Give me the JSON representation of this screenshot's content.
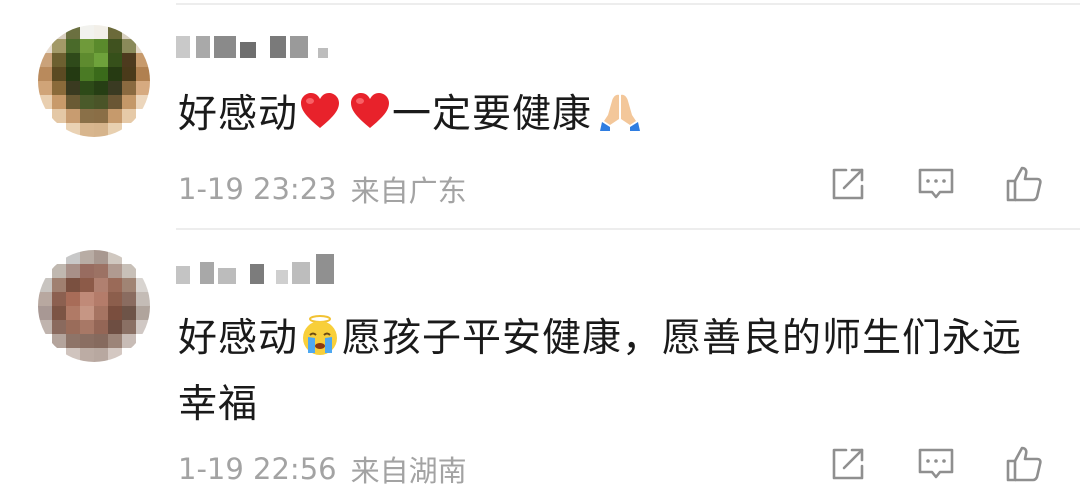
{
  "comments": [
    {
      "text_before": "好感动",
      "text_after": "一定要健康",
      "date": "1-19 23:23",
      "location": "来自广东",
      "avatar_colors": [
        "#fff",
        "#d9cfc0",
        "#6b7040",
        "#f2f2ee",
        "#f2efe8",
        "#6b6a3a",
        "#d8d0bf",
        "#fff",
        "#e8ddd0",
        "#a39a68",
        "#4a6a2a",
        "#6f9a3a",
        "#5a8a2c",
        "#40521f",
        "#8a8a5a",
        "#e6dacb",
        "#caa27a",
        "#6d6030",
        "#2f4a1a",
        "#5e8b2f",
        "#6ea23b",
        "#36501a",
        "#4d3a1e",
        "#c79a6c",
        "#b98a5c",
        "#5b4a22",
        "#243a12",
        "#4a7a24",
        "#3a6a1a",
        "#263a12",
        "#4a3a1a",
        "#b08050",
        "#d0a478",
        "#8a6a3a",
        "#3a3a20",
        "#2d4a18",
        "#263e14",
        "#3a3a22",
        "#8a6a40",
        "#d6aa80",
        "#e9cfb0",
        "#c89a6a",
        "#6a5a34",
        "#4a5a2a",
        "#4a5428",
        "#6a5634",
        "#c49868",
        "#ecd6bc",
        "#fff",
        "#e4c8a6",
        "#c89c70",
        "#8a7048",
        "#8a6e46",
        "#c69a6c",
        "#e6caa8",
        "#fff",
        "#fff",
        "#fff",
        "#ead2b4",
        "#d8b68e",
        "#d6b48c",
        "#e8d0b0",
        "#fff",
        "#fff"
      ]
    },
    {
      "text_before": "好感动",
      "text_after": "愿孩子平安健康，愿善良的师生们永远幸福",
      "date": "1-19 22:56",
      "location": "来自湖南",
      "avatar_colors": [
        "#fff",
        "#fff",
        "#c8c8c8",
        "#b8aca4",
        "#a89890",
        "#d0c8c0",
        "#fff",
        "#fff",
        "#fff",
        "#c0b8b0",
        "#a89088",
        "#986c60",
        "#9c7264",
        "#b09a90",
        "#c8c0b8",
        "#fff",
        "#c8c4c0",
        "#a08070",
        "#7a5040",
        "#8c5a48",
        "#b08070",
        "#9a6a58",
        "#a08474",
        "#d8d4d0",
        "#b8a8a0",
        "#8c6050",
        "#a86c58",
        "#c08a78",
        "#b47c6a",
        "#8c5e4c",
        "#8a6c60",
        "#c4bcb6",
        "#a89894",
        "#7c5444",
        "#b07a66",
        "#c69684",
        "#a67462",
        "#7a4e3e",
        "#6e5448",
        "#b0a49c",
        "#c0b4ae",
        "#8a6a5e",
        "#9a6c5a",
        "#a87866",
        "#946656",
        "#6e4e42",
        "#8a7064",
        "#d0c8c4",
        "#fff",
        "#b4a49c",
        "#8e7468",
        "#8a6e62",
        "#866a5e",
        "#9c8478",
        "#c8bcb6",
        "#fff",
        "#fff",
        "#fff",
        "#d0c4be",
        "#bcaca4",
        "#b8a8a0",
        "#d4c8c2",
        "#fff",
        "#fff"
      ]
    }
  ],
  "icons": {
    "share": "share-icon",
    "comment": "comment-icon",
    "like": "like-icon"
  },
  "colors": {
    "meta": "#a3a3a3",
    "text": "#1a1a1a",
    "heart": "#e8222b"
  }
}
